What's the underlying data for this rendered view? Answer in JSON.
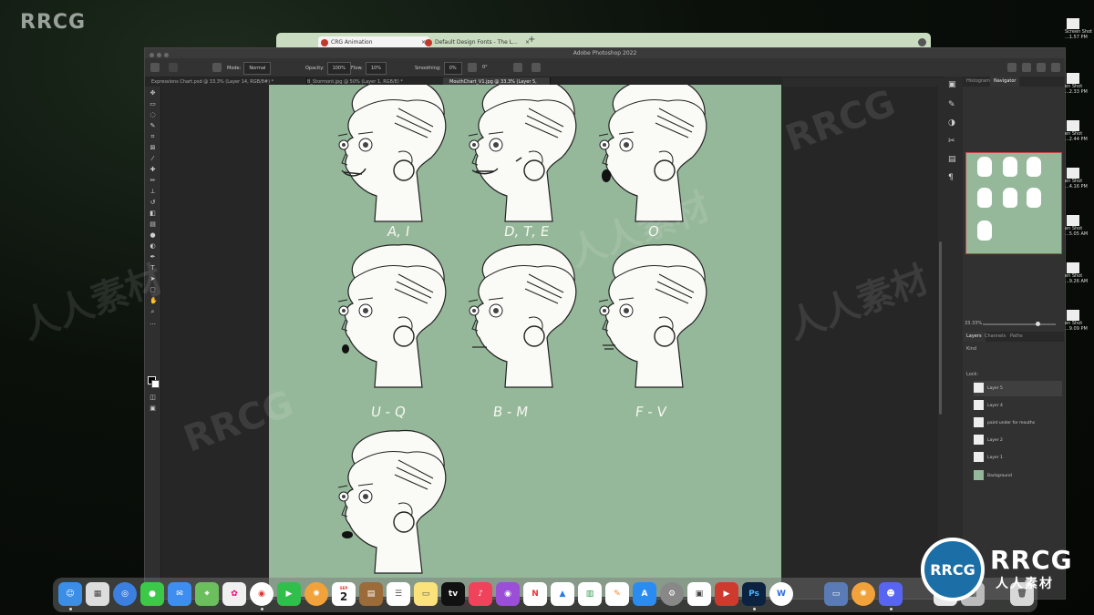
{
  "watermark": {
    "top_left": "RRCG",
    "logo_text": "RRCG",
    "logo_sub": "人人素材",
    "repeat_cn": "人人素材",
    "repeat_en": "RRCG"
  },
  "browser": {
    "tabs": [
      {
        "label": "CRG Animation"
      },
      {
        "label": "Default Design Fonts - The L..."
      }
    ]
  },
  "photoshop": {
    "title": "Adobe Photoshop 2022",
    "options": {
      "mode_label": "Mode:",
      "mode_value": "Normal",
      "opacity_label": "Opacity:",
      "opacity_value": "100%",
      "flow_label": "Flow:",
      "flow_value": "10%",
      "smoothing_label": "Smoothing:",
      "smoothing_value": "0%",
      "angle_value": "0°"
    },
    "doc_tabs": [
      {
        "label": "Expressions Chart.psd @ 33.3% (Layer 14, RGB/8#) *"
      },
      {
        "label": "B_Stormont.jpg @ 50% (Layer 1, RGB/8) *"
      },
      {
        "label": "MouthChart_V1.jpg @ 33.3% (Layer 5, RGB/8) *",
        "active": true
      }
    ],
    "canvas_labels": [
      "A, I",
      "D, T, E",
      "O",
      "U - Q",
      "B - M",
      "F - V"
    ],
    "panel_tabs": [
      "Histogram",
      "Navigator"
    ],
    "zoom": "33.33%",
    "layer_tabs": [
      "Layers",
      "Channels",
      "Paths"
    ],
    "layer_kind": "Kind",
    "layer_lock": "Lock:",
    "layers": [
      {
        "name": "Layer 5",
        "selected": true
      },
      {
        "name": "Layer 4"
      },
      {
        "name": "paint under for mouths"
      },
      {
        "name": "Layer 2"
      },
      {
        "name": "Layer 1"
      },
      {
        "name": "Background"
      }
    ]
  },
  "desktop_shots": [
    {
      "line1": "Screen Shot",
      "line2": "...1.57 PM"
    },
    {
      "line1": "en Shot",
      "line2": "...2.33 PM"
    },
    {
      "line1": "en Shot",
      "line2": "...2.44 PM"
    },
    {
      "line1": "en Shot",
      "line2": "...4.16 PM"
    },
    {
      "line1": "en Shot",
      "line2": "...5.05 AM"
    },
    {
      "line1": "en Shot",
      "line2": "...9.26 AM"
    },
    {
      "line1": "en Shot",
      "line2": "...9.09 PM"
    }
  ],
  "dock": {
    "calendar_day": "2",
    "calendar_month": "SEP",
    "tv_label": "tv",
    "ps_label": "Ps",
    "w_label": "W",
    "icons": [
      "finder",
      "launchpad",
      "safari",
      "messages",
      "mail",
      "maps",
      "photos",
      "chrome",
      "facetime",
      "sunflower",
      "calendar",
      "notes-brown",
      "reminders",
      "notes",
      "apple-tv",
      "music",
      "podcasts",
      "news",
      "keynote",
      "numbers",
      "pages",
      "app-store",
      "system-preferences",
      "flashcard",
      "photoshop",
      "word",
      "preview",
      "sunflower2",
      "discord",
      "documents",
      "trash"
    ]
  }
}
